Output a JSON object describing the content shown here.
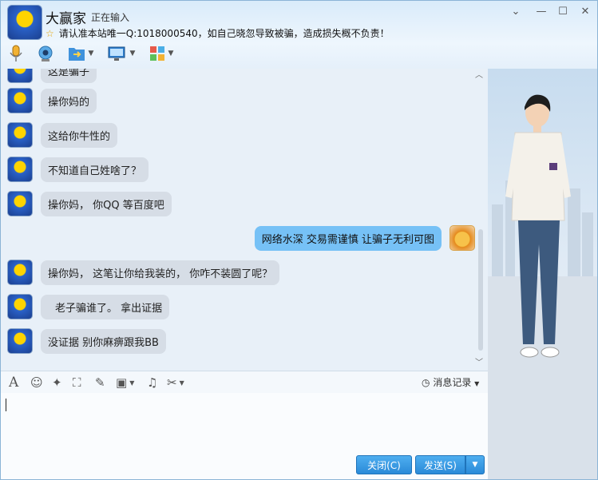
{
  "header": {
    "contact_name": "大赢家",
    "status": "正在输入",
    "notice": "请认准本站唯一Q:1018000540，如自己晓忽导致被骗，造成损失概不负责！"
  },
  "window_controls": {
    "menu": "⌄",
    "minimize": "—",
    "maximize": "☐",
    "close": "✕"
  },
  "toolbar": {
    "icons": [
      "voice-call-icon",
      "video-call-icon",
      "file-transfer-icon",
      "screen-share-icon",
      "apps-icon"
    ]
  },
  "messages": [
    {
      "side": "left",
      "text": "这是骗子"
    },
    {
      "side": "left",
      "text": "操你妈的"
    },
    {
      "side": "left",
      "text": "这给你牛性的"
    },
    {
      "side": "left",
      "text": "不知道自己姓啥了？"
    },
    {
      "side": "left",
      "text": "操你妈，  你QQ 等百度吧"
    },
    {
      "side": "right",
      "text": "网络水深 交易需谨慎 让骗子无利可图"
    },
    {
      "side": "left",
      "text": "操你妈，  这笔让你给我装的，  你咋不装圆了呢？"
    },
    {
      "side": "left",
      "text": "老子骗谁了。  拿出证据"
    },
    {
      "side": "left",
      "text": "没证据 别你麻痹跟我BB"
    }
  ],
  "input_toolbar": {
    "history_label": "消息记录",
    "icons": [
      "font-icon",
      "emoji-icon",
      "magic-icon",
      "screenshot-icon",
      "edit-icon",
      "image-icon",
      "music-icon",
      "scissors-icon"
    ]
  },
  "buttons": {
    "close_label": "关闭(C)",
    "send_label": "发送(S)"
  },
  "colors": {
    "bubble_incoming": "#d6dde6",
    "bubble_outgoing": "#76c1f6",
    "button": "#2a8ad8"
  }
}
